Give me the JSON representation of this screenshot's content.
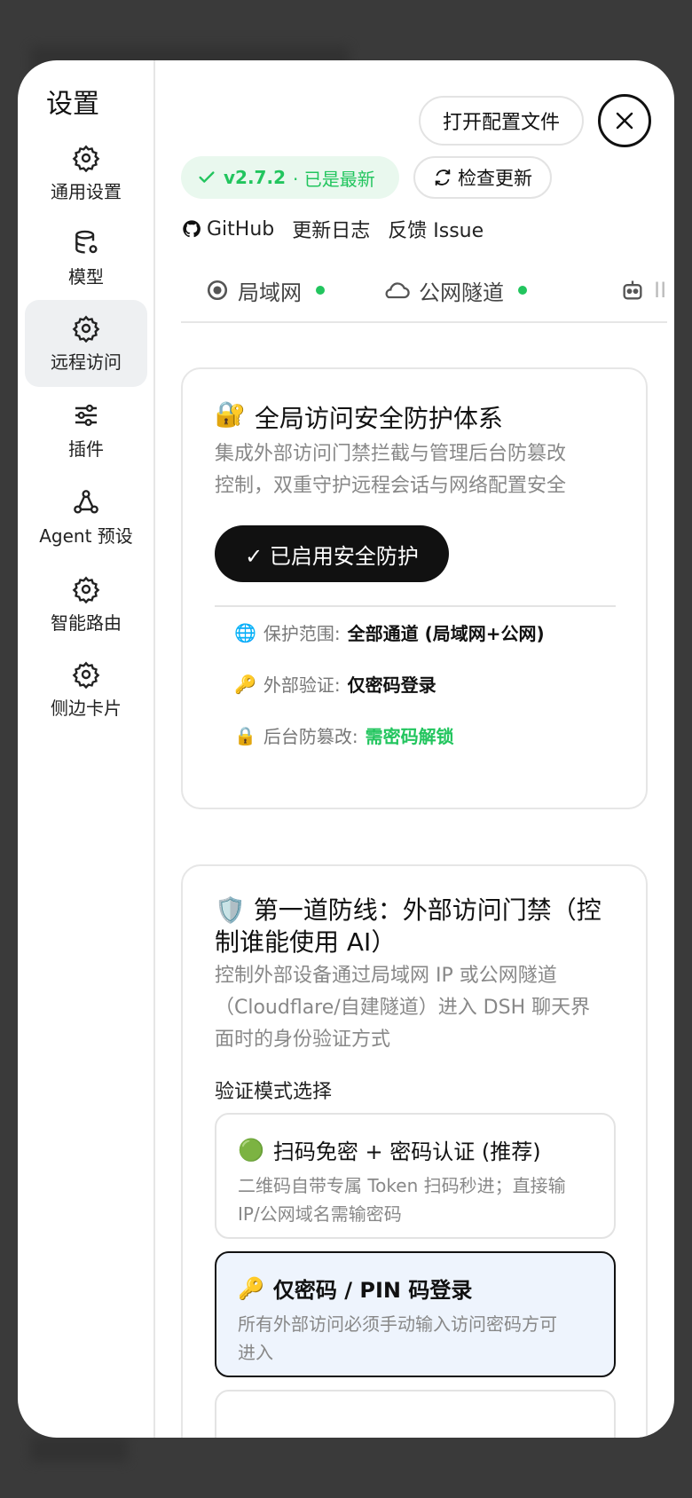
{
  "sidebar": {
    "title": "设置",
    "items": [
      {
        "label": "通用设置",
        "icon": "gear-icon"
      },
      {
        "label": "模型",
        "icon": "database-gear-icon"
      },
      {
        "label": "远程访问",
        "icon": "gear-icon",
        "active": true
      },
      {
        "label": "插件",
        "icon": "sliders-icon"
      },
      {
        "label": "Agent 预设",
        "icon": "nodes-icon"
      },
      {
        "label": "智能路由",
        "icon": "gear-icon"
      },
      {
        "label": "侧边卡片",
        "icon": "gear-icon"
      }
    ]
  },
  "header": {
    "open_config": "打开配置文件",
    "version": "v2.7.2",
    "version_status": "· 已是最新",
    "check_update": "检查更新",
    "links": {
      "github": "GitHub",
      "changelog": "更新日志",
      "feedback": "反馈 Issue"
    }
  },
  "tabs": [
    {
      "label": "局域网",
      "status": "online"
    },
    {
      "label": "公网隧道",
      "status": "online"
    },
    {
      "label": "II",
      "status": ""
    }
  ],
  "security_card": {
    "icon": "🔐",
    "title": "全局访问安全防护体系",
    "desc_line1": "集成外部访问门禁拦截与管理后台防篡改",
    "desc_line2": "控制，双重守护远程会话与网络配置安全",
    "enabled_button": "✓ 已启用安全防护",
    "rows": [
      {
        "icon": "🌐",
        "label": "保护范围:",
        "value": "全部通道 (局域网+公网)"
      },
      {
        "icon": "🔑",
        "label": "外部验证:",
        "value": "仅密码登录"
      },
      {
        "icon": "🔒",
        "label": "后台防篡改:",
        "value": "需密码解锁"
      }
    ]
  },
  "defense_card": {
    "icon": "🛡️",
    "title_line1": "第一道防线：外部访问门禁（控",
    "title_line2": "制谁能使用 AI）",
    "desc_line1": "控制外部设备通过局域网 IP 或公网隧道",
    "desc_line2": "（Cloudflare/自建隧道）进入 DSH 聊天界",
    "desc_line3": "面时的身份验证方式",
    "mode_label": "验证模式选择",
    "options": [
      {
        "icon": "🟢",
        "title": "扫码免密 + 密码认证 (推荐)",
        "desc_line1": "二维码自带专属 Token 扫码秒进；直接输",
        "desc_line2": "IP/公网域名需输密码"
      },
      {
        "icon": "🔑",
        "title": "仅密码 / PIN 码登录",
        "desc_line1": "所有外部访问必须手动输入访问密码方可",
        "desc_line2": "进入",
        "selected": true
      }
    ]
  },
  "colors": {
    "accent_green": "#22c55e",
    "selected_bg": "#eef4fd",
    "dark": "#111111"
  }
}
